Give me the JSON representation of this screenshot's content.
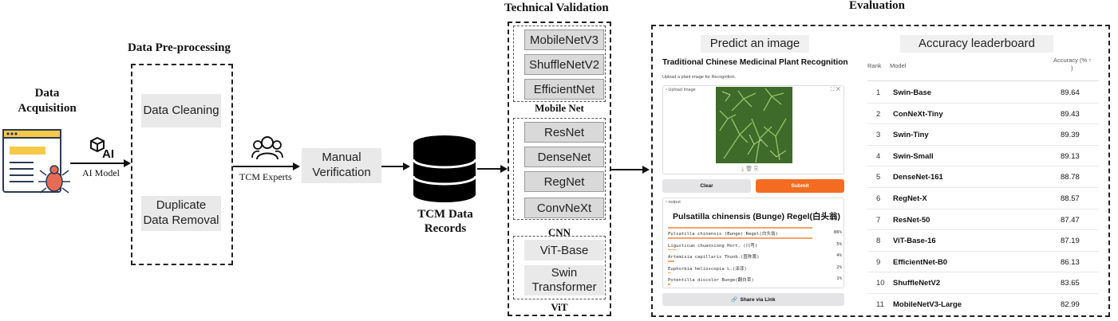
{
  "acquisition": {
    "title_line1": "Data",
    "title_line2": "Acquisition",
    "ai_label": "AI Model"
  },
  "preprocessing": {
    "title": "Data Pre-processing",
    "step1": "Data Cleaning",
    "step2_line1": "Duplicate",
    "step2_line2": "Data Removal"
  },
  "experts": {
    "label": "TCM Experts"
  },
  "verification": {
    "line1": "Manual",
    "line2": "Verification"
  },
  "records": {
    "line1": "TCM Data",
    "line2": "Records"
  },
  "validation": {
    "title": "Technical Validation",
    "groups": [
      {
        "label": "Mobile Net",
        "models": [
          "MobileNetV3",
          "ShuffleNetV2",
          "EfficientNet"
        ]
      },
      {
        "label": "CNN",
        "models": [
          "ResNet",
          "DenseNet",
          "RegNet",
          "ConvNeXt"
        ]
      },
      {
        "label": "ViT",
        "models": [
          "ViT-Base",
          "Swin",
          "Transformer"
        ]
      }
    ]
  },
  "evaluation": {
    "title": "Evaluation",
    "predict": {
      "header": "Predict an image",
      "app_title": "Traditional Chinese Medicinal Plant Recognition",
      "subtitle": "Upload a plant image for Recognition.",
      "upload_label": "Upload Image",
      "clear_label": "Clear",
      "submit_label": "Submit",
      "output_label": "output",
      "result_title": "Pulsatilla chinensis (Bunge) Regel(白头翁)",
      "predictions": [
        {
          "name": "Pulsatilla chinensis (Bunge) Regel(白头翁)",
          "pct": "86%",
          "value": 0.86
        },
        {
          "name": "Ligusticum chuanxiong Hort. (川芎)",
          "pct": "5%",
          "value": 0.05
        },
        {
          "name": "Artemisia capillaris Thunb.(茵陈蒿)",
          "pct": "4%",
          "value": 0.04
        },
        {
          "name": "Euphorbia helioscopia L.(泽漆)",
          "pct": "2%",
          "value": 0.02
        },
        {
          "name": "Potentilla discolor Bunge(翻白草)",
          "pct": "1%",
          "value": 0.01
        }
      ],
      "share_label": "Share via Link"
    },
    "leaderboard": {
      "header": "Accuracy leaderboard",
      "col_rank": "Rank",
      "col_model": "Model",
      "col_acc_line1": "Accuracy (% ↑",
      "col_acc_line2": ")",
      "rows": [
        {
          "rank": "1",
          "model": "Swin-Base",
          "acc": "89.64"
        },
        {
          "rank": "2",
          "model": "ConNeXt-Tiny",
          "acc": "89.43"
        },
        {
          "rank": "3",
          "model": "Swin-Tiny",
          "acc": "89.39"
        },
        {
          "rank": "4",
          "model": "Swin-Small",
          "acc": "89.13"
        },
        {
          "rank": "5",
          "model": "DenseNet-161",
          "acc": "88.78"
        },
        {
          "rank": "6",
          "model": "RegNet-X",
          "acc": "88.57"
        },
        {
          "rank": "7",
          "model": "ResNet-50",
          "acc": "87.47"
        },
        {
          "rank": "8",
          "model": "ViT-Base-16",
          "acc": "87.19"
        },
        {
          "rank": "9",
          "model": "EfficientNet-B0",
          "acc": "86.13"
        },
        {
          "rank": "10",
          "model": "ShuffleNetV2",
          "acc": "83.65"
        },
        {
          "rank": "11",
          "model": "MobileNetV3-Large",
          "acc": "82.99"
        }
      ]
    }
  },
  "colors": {
    "submit": "#f36c21",
    "dashed_border": "#222222",
    "gray_box": "#e9e9e9",
    "model_box": "#d9d9d9"
  }
}
